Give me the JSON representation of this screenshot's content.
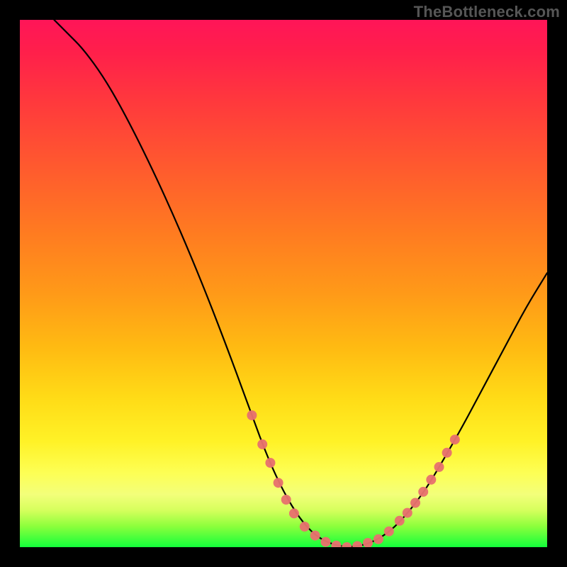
{
  "watermark": "TheBottleneck.com",
  "chart_data": {
    "type": "line",
    "title": "",
    "xlabel": "",
    "ylabel": "",
    "xlim": [
      0,
      100
    ],
    "ylim": [
      0,
      100
    ],
    "grid": false,
    "legend": false,
    "series": [
      {
        "name": "bottleneck-curve",
        "points": [
          {
            "x": 6.5,
            "y": 100
          },
          {
            "x": 9,
            "y": 97.5
          },
          {
            "x": 12,
            "y": 94.5
          },
          {
            "x": 16,
            "y": 89
          },
          {
            "x": 20,
            "y": 82
          },
          {
            "x": 25,
            "y": 72
          },
          {
            "x": 30,
            "y": 61
          },
          {
            "x": 35,
            "y": 49
          },
          {
            "x": 40,
            "y": 36
          },
          {
            "x": 44,
            "y": 25
          },
          {
            "x": 47,
            "y": 17
          },
          {
            "x": 50,
            "y": 10.5
          },
          {
            "x": 53,
            "y": 5.5
          },
          {
            "x": 56,
            "y": 2.2
          },
          {
            "x": 59,
            "y": 0.6
          },
          {
            "x": 62,
            "y": 0
          },
          {
            "x": 65,
            "y": 0.3
          },
          {
            "x": 68,
            "y": 1.5
          },
          {
            "x": 71,
            "y": 3.7
          },
          {
            "x": 74,
            "y": 7
          },
          {
            "x": 77,
            "y": 11
          },
          {
            "x": 80,
            "y": 16
          },
          {
            "x": 84,
            "y": 23
          },
          {
            "x": 88,
            "y": 30.5
          },
          {
            "x": 92,
            "y": 38
          },
          {
            "x": 96,
            "y": 45.5
          },
          {
            "x": 100,
            "y": 52
          }
        ]
      },
      {
        "name": "highlighted-range-markers",
        "points": [
          {
            "x": 44,
            "y": 25
          },
          {
            "x": 46,
            "y": 19.5
          },
          {
            "x": 47.5,
            "y": 16
          },
          {
            "x": 49,
            "y": 12.2
          },
          {
            "x": 50.5,
            "y": 9
          },
          {
            "x": 52,
            "y": 6.4
          },
          {
            "x": 54,
            "y": 3.9
          },
          {
            "x": 56,
            "y": 2.2
          },
          {
            "x": 58,
            "y": 1
          },
          {
            "x": 60,
            "y": 0.3
          },
          {
            "x": 62,
            "y": 0
          },
          {
            "x": 64,
            "y": 0.2
          },
          {
            "x": 66,
            "y": 0.8
          },
          {
            "x": 68,
            "y": 1.5
          },
          {
            "x": 70,
            "y": 3
          },
          {
            "x": 72,
            "y": 5
          },
          {
            "x": 73.5,
            "y": 6.5
          },
          {
            "x": 75,
            "y": 8.4
          },
          {
            "x": 76.5,
            "y": 10.5
          },
          {
            "x": 78,
            "y": 12.8
          },
          {
            "x": 79.5,
            "y": 15.2
          },
          {
            "x": 81,
            "y": 17.9
          },
          {
            "x": 82.5,
            "y": 20.4
          }
        ]
      }
    ],
    "gradient_stops": [
      {
        "pos": 0,
        "color": "#ff1558"
      },
      {
        "pos": 16,
        "color": "#ff3a3c"
      },
      {
        "pos": 40,
        "color": "#ff7a21"
      },
      {
        "pos": 62,
        "color": "#ffba12"
      },
      {
        "pos": 80,
        "color": "#fff227"
      },
      {
        "pos": 93,
        "color": "#d6ff5d"
      },
      {
        "pos": 100,
        "color": "#13ff3b"
      }
    ]
  }
}
